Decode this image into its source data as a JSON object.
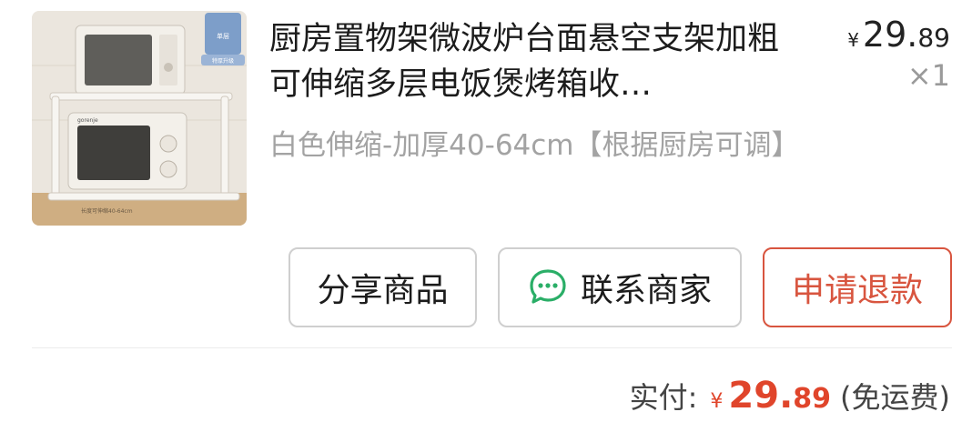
{
  "product": {
    "title": "厨房置物架微波炉台面悬空支架加粗可伸缩多层电饭煲烤箱收…",
    "sku": "白色伸缩-加厚40-64cm【根据厨房可调】",
    "price": {
      "currency": "¥",
      "integer": "29.",
      "decimal": "89"
    },
    "quantity": "×1",
    "image": {
      "badge": "单层",
      "tag": "特厚升级",
      "caption": "长度可伸缩40-64cm",
      "brand": "gorenje"
    }
  },
  "actions": {
    "share": "分享商品",
    "contact": "联系商家",
    "refund": "申请退款"
  },
  "total": {
    "label": "实付:",
    "currency": "¥",
    "integer": "29.",
    "decimal": "89",
    "shipping": "(免运费)"
  },
  "colors": {
    "accent": "#e0452b",
    "refund_border": "#d8553f",
    "muted": "#a3a3a3",
    "chat_icon": "#2aae67"
  },
  "icons": {
    "contact": "chat-bubble-icon"
  }
}
